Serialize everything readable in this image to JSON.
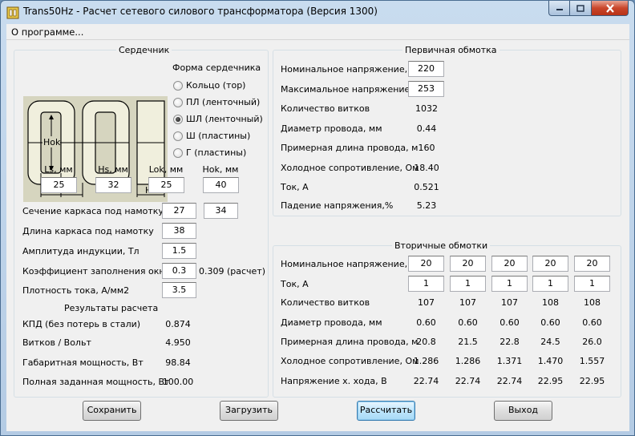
{
  "window": {
    "title": "Trans50Hz - Расчет сетевого силового трансформатора (Версия 1300)"
  },
  "menu": {
    "about": "О программе..."
  },
  "core": {
    "title": "Сердечник",
    "diagram_labels": {
      "hok": "Hok",
      "lok": "Lok",
      "ls": "Ls",
      "hs": "Hs"
    },
    "shape_label": "Форма сердечника",
    "shapes": [
      {
        "label": "Кольцо  (тор)",
        "selected": false
      },
      {
        "label": "ПЛ  (ленточный)",
        "selected": false
      },
      {
        "label": "ШЛ  (ленточный)",
        "selected": true
      },
      {
        "label": "Ш  (пластины)",
        "selected": false
      },
      {
        "label": "Г (пластины)",
        "selected": false
      }
    ],
    "dims": [
      {
        "label": "Ls, мм",
        "value": "25"
      },
      {
        "label": "Hs, мм",
        "value": "32"
      },
      {
        "label": "Lok, мм",
        "value": "25"
      },
      {
        "label": "Hok, мм",
        "value": "40"
      }
    ]
  },
  "params": {
    "section_label": "Сечение каркаса под намотку",
    "section_a": "27",
    "section_b": "34",
    "length_label": "Длина каркаса под намотку",
    "length": "38",
    "induction_label": "Амплитуда индукции, Тл",
    "induction": "1.5",
    "fill_label": "Коэффициент заполнения окна",
    "fill": "0.3",
    "fill_calc": "0.309 (расчет)",
    "current_density_label": "Плотность тока, А/мм2",
    "current_density": "3.5"
  },
  "results": {
    "title": "Результаты расчета",
    "rows": [
      {
        "label": "КПД (без потерь в стали)",
        "value": "0.874"
      },
      {
        "label": "Витков / Вольт",
        "value": "4.950"
      },
      {
        "label": "Габаритная мощность, Вт",
        "value": "98.84"
      },
      {
        "label": "Полная заданная мощность, Вт",
        "value": "100.00"
      }
    ]
  },
  "primary": {
    "title": "Первичная обмотка",
    "nominal_label": "Номинальное напряжение, В",
    "nominal": "220",
    "max_label": "Максимальное напряжение, В",
    "max": "253",
    "rows": [
      {
        "label": "Количество витков",
        "value": "1032"
      },
      {
        "label": "Диаметр провода, мм",
        "value": "0.44"
      },
      {
        "label": "Примерная длина провода, м",
        "value": "160"
      },
      {
        "label": "Холодное сопротивление, Ом",
        "value": "18.40"
      },
      {
        "label": "Ток, А",
        "value": "0.521"
      },
      {
        "label": "Падение напряжения,%",
        "value": "5.23"
      }
    ]
  },
  "secondary": {
    "title": "Вторичные обмотки",
    "voltage_label": "Номинальное напряжение, В",
    "voltages": [
      "20",
      "20",
      "20",
      "20",
      "20"
    ],
    "current_label": "Ток, А",
    "currents": [
      "1",
      "1",
      "1",
      "1",
      "1"
    ],
    "rows": [
      {
        "label": "Количество витков",
        "values": [
          "107",
          "107",
          "107",
          "108",
          "108"
        ]
      },
      {
        "label": "Диаметр провода, мм",
        "values": [
          "0.60",
          "0.60",
          "0.60",
          "0.60",
          "0.60"
        ]
      },
      {
        "label": "Примерная длина провода, м",
        "values": [
          "20.8",
          "21.5",
          "22.8",
          "24.5",
          "26.0"
        ]
      },
      {
        "label": "Холодное сопротивление, Ом",
        "values": [
          "1.286",
          "1.286",
          "1.371",
          "1.470",
          "1.557"
        ]
      },
      {
        "label": "Напряжение х. хода, В",
        "values": [
          "22.74",
          "22.74",
          "22.74",
          "22.95",
          "22.95"
        ]
      }
    ]
  },
  "buttons": {
    "save": "Сохранить",
    "load": "Загрузить",
    "calc": "Рассчитать",
    "exit": "Выход"
  },
  "colors": {
    "titlebar": "#b9cfe7",
    "client": "#f0f0f0",
    "close": "#c9462b",
    "focus": "#3c7fb1"
  }
}
